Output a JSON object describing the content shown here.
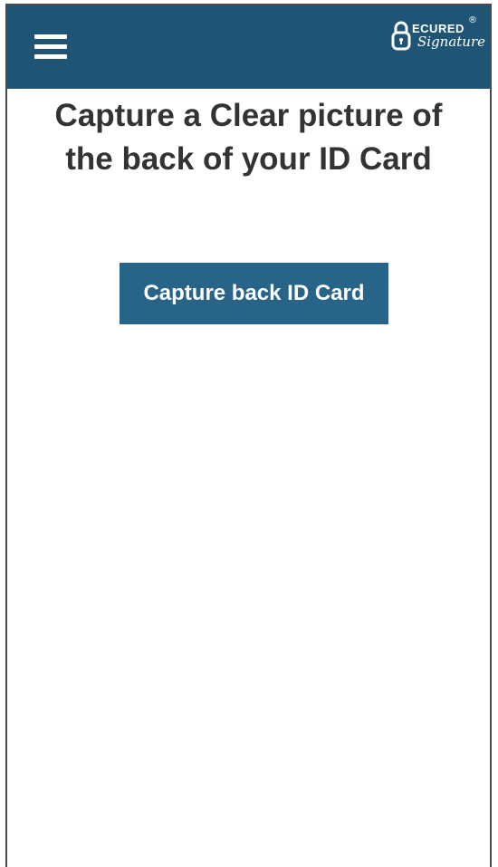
{
  "header": {
    "menu_icon": "hamburger-menu-icon",
    "logo": {
      "top_text": "ECURED",
      "bottom_text": "Signature",
      "registered_mark": "®"
    },
    "background_color": "#1f5475"
  },
  "main": {
    "heading_line1": "Capture a Clear picture of",
    "heading_line2": "the back of your ID Card",
    "capture_button_label": "Capture back ID Card",
    "button_color": "#286388"
  }
}
